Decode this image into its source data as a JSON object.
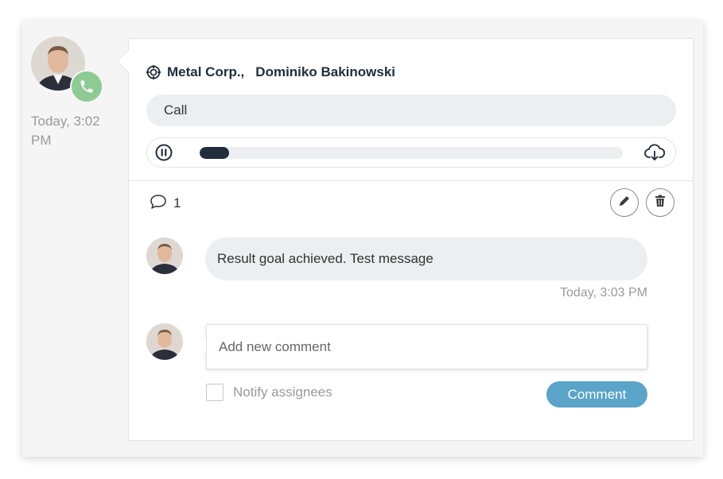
{
  "activity": {
    "time": "Today, 3:02 PM",
    "company": "Metal Corp.,",
    "contact": "Dominiko Bakinowski",
    "type_label": "Call",
    "playback_progress": 0.07
  },
  "comments": {
    "count": "1",
    "items": [
      {
        "text": "Result goal achieved. Test message",
        "time": "Today, 3:03 PM"
      }
    ],
    "input_placeholder": "Add new comment",
    "notify_label": "Notify assignees",
    "submit_label": "Comment"
  },
  "icons": {
    "call_badge": "phone-icon",
    "company": "target-icon",
    "player_pause": "pause-icon",
    "player_download": "cloud-download-icon",
    "comments": "speech-bubble-icon",
    "edit": "pencil-icon",
    "delete": "trash-icon"
  },
  "colors": {
    "call_badge": "#8ecb93",
    "accent": "#5aa3c9",
    "progress": "#1f2d3d"
  }
}
